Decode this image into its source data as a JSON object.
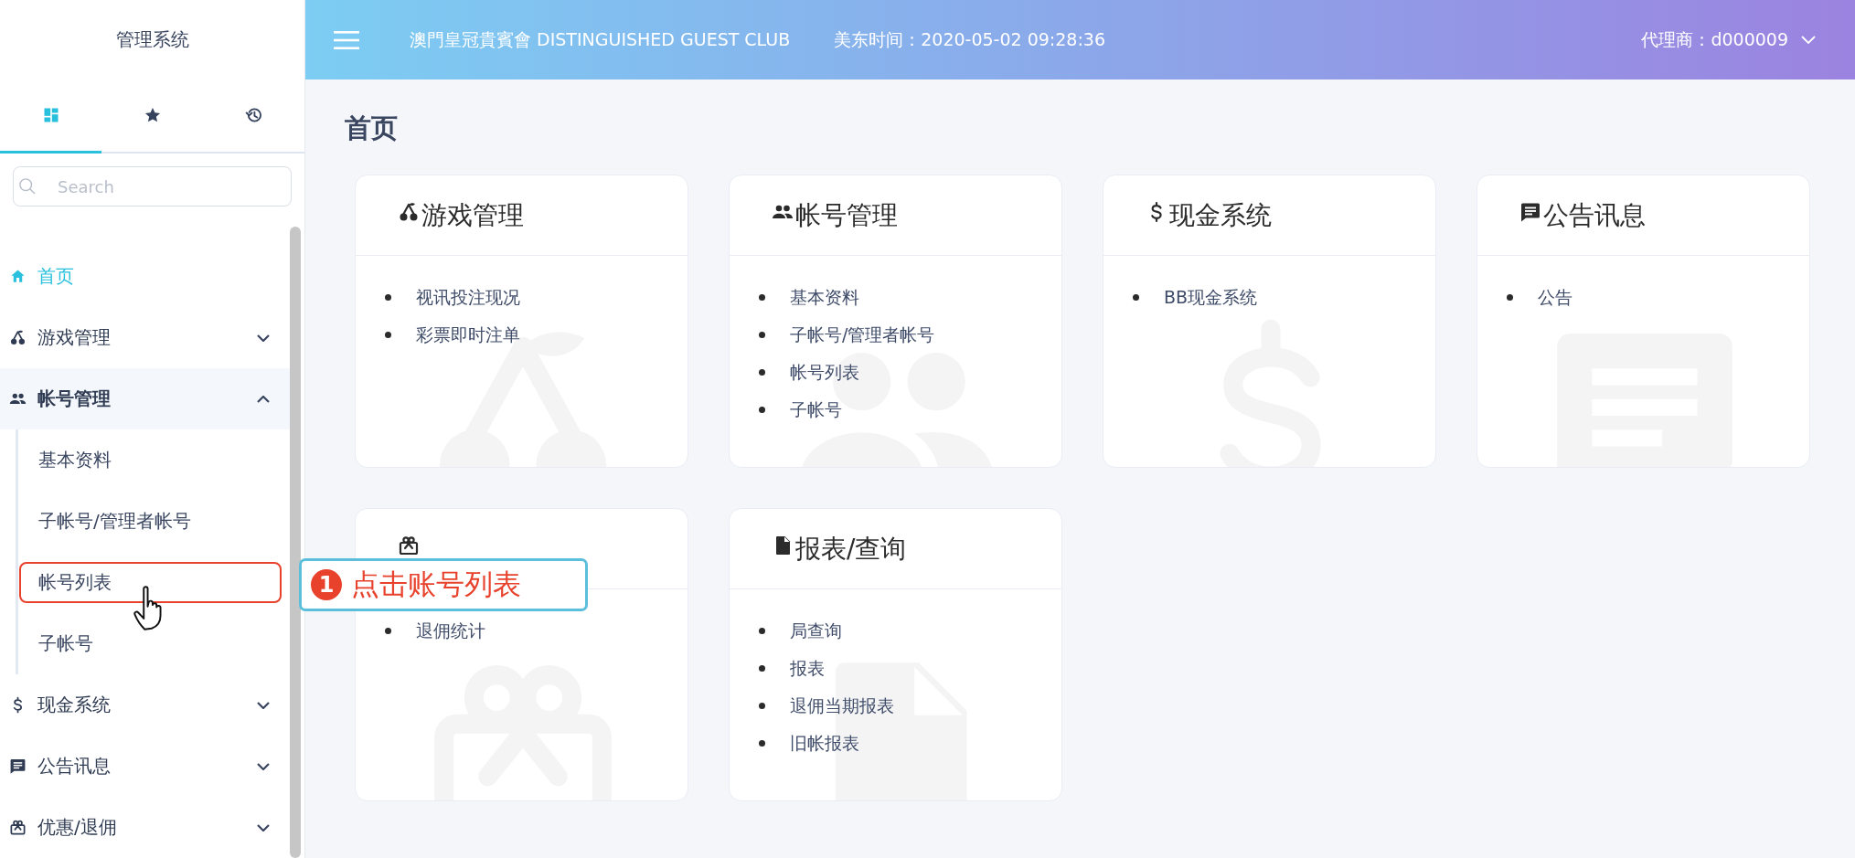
{
  "sidebar": {
    "title": "管理系统",
    "tabs": [
      {
        "kind": "dashboard",
        "selected": true
      },
      {
        "kind": "favorites",
        "selected": false
      },
      {
        "kind": "history",
        "selected": false
      }
    ],
    "search": {
      "placeholder": "Search"
    },
    "menu": [
      {
        "kind": "home",
        "label": "首页",
        "selected": true
      },
      {
        "kind": "games",
        "label": "游戏管理",
        "selected": false,
        "expanded": false
      },
      {
        "kind": "accounts",
        "label": "帐号管理",
        "selected": false,
        "expanded": true,
        "children": [
          {
            "label": "基本资料",
            "highlighted": false
          },
          {
            "label": "子帐号/管理者帐号",
            "highlighted": false
          },
          {
            "label": "帐号列表",
            "highlighted": true
          },
          {
            "label": "子帐号",
            "highlighted": false
          }
        ]
      },
      {
        "kind": "cash",
        "label": "现金系统",
        "selected": false,
        "expanded": false
      },
      {
        "kind": "notices",
        "label": "公告讯息",
        "selected": false,
        "expanded": false
      },
      {
        "kind": "promotions",
        "label": "优惠/退佣",
        "selected": false,
        "expanded": false
      }
    ]
  },
  "header": {
    "brand": "澳門皇冠貴賓會 DISTINGUISHED GUEST CLUB",
    "time": "美东时间：2020-05-02 09:28:36",
    "agent": "代理商：d000009"
  },
  "page_title": "首页",
  "cards": [
    {
      "kind": "games",
      "title": "游戏管理",
      "links": [
        "视讯投注现况",
        "彩票即时注单"
      ]
    },
    {
      "kind": "accounts",
      "title": "帐号管理",
      "links": [
        "基本资料",
        "子帐号/管理者帐号",
        "帐号列表",
        "子帐号"
      ]
    },
    {
      "kind": "cash",
      "title": "现金系统",
      "links": [
        "BB现金系统"
      ]
    },
    {
      "kind": "notices",
      "title": "公告讯息",
      "links": [
        "公告"
      ]
    },
    {
      "kind": "promotions",
      "links": [
        "退佣统计"
      ]
    },
    {
      "kind": "reports",
      "title": "报表/查询",
      "links": [
        "局查询",
        "报表",
        "退佣当期报表",
        "旧帐报表"
      ]
    }
  ],
  "annotation": {
    "step": "1",
    "text": "点击账号列表"
  }
}
